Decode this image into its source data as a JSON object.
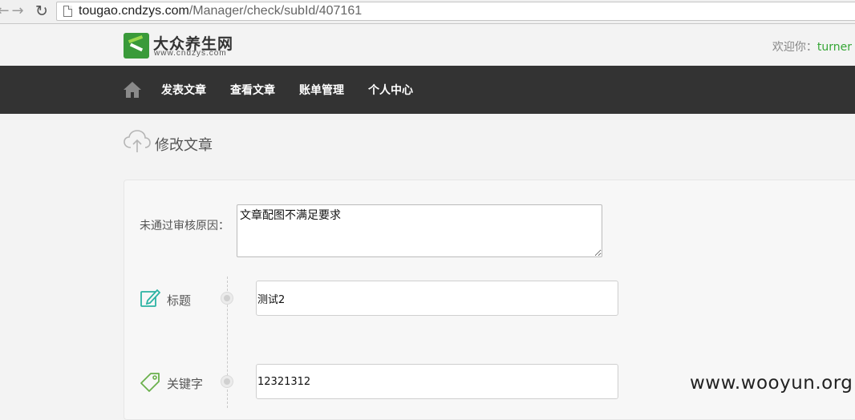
{
  "browser": {
    "url_host": "tougao.cndzys.com",
    "url_path": "/Manager/check/subId/407161"
  },
  "header": {
    "logo_cn": "大众养生网",
    "logo_en": "www.cndzys.com",
    "welcome_prefix": "欢迎你：",
    "username": "turner"
  },
  "nav": {
    "items": [
      "发表文章",
      "查看文章",
      "账单管理",
      "个人中心"
    ]
  },
  "page": {
    "title": "修改文章"
  },
  "form": {
    "reason_label": "未通过审核原因：",
    "reason_value": "文章配图不满足要求",
    "title_label": "标题",
    "title_value": "测试2",
    "keywords_label": "关键字",
    "keywords_value": "12321312"
  },
  "watermark": "www.wooyun.org",
  "colors": {
    "nav_bg": "#333333",
    "accent_green": "#35a635",
    "icon_teal": "#2bb3a3",
    "tag_green": "#6ab04c"
  }
}
